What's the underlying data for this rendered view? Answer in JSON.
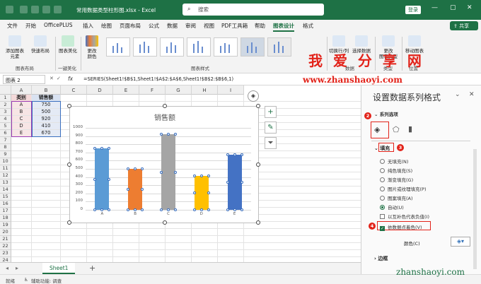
{
  "titlebar": {
    "file_name": "常用数据类型柱形图.xlsx - Excel",
    "search_placeholder": "搜索",
    "login_label": "登录"
  },
  "tabs": [
    "文件",
    "开始",
    "OfficePLUS",
    "插入",
    "绘图",
    "页面布局",
    "公式",
    "数据",
    "审阅",
    "视图",
    "PDF工具箱",
    "帮助",
    "图表设计",
    "格式"
  ],
  "active_tab": "图表设计",
  "share_label": "共享",
  "ribbon": {
    "add_element": "添加图表\n元素",
    "quick_layout": "快速布局",
    "beautify": "图表美化",
    "change_colors": "更改\n颜色",
    "switch_row_col": "切换行/列",
    "select_data": "选择数据",
    "change_type": "更改\n图表类型",
    "move_chart": "移动图表",
    "group_layout": "图表布局",
    "group_onekey": "一键美化",
    "group_styles": "图表样式",
    "group_data": "数据",
    "group_type": "类型",
    "group_location": "位置"
  },
  "watermark": {
    "cn": "我 爱 分 享 网",
    "url": "www.zhanshaoyi.com",
    "url2": "zhanshaoyi.com"
  },
  "formula_bar": {
    "name_box": "图表 2",
    "fx": "fx",
    "formula": "=SERIES(Sheet1!$B$1,Sheet1!$A$2:$A$6,Sheet1!$B$2:$B$6,1)"
  },
  "columns": [
    "A",
    "B",
    "C",
    "D",
    "E",
    "F",
    "G",
    "H",
    "I"
  ],
  "rows": [
    "1",
    "2",
    "3",
    "4",
    "5",
    "6",
    "7",
    "8",
    "9",
    "10",
    "11",
    "12",
    "13",
    "14",
    "15",
    "16",
    "17",
    "18",
    "19",
    "20",
    "21",
    "22",
    "23",
    "24"
  ],
  "table": {
    "header": [
      "类别",
      "销售额"
    ],
    "rows": [
      [
        "A",
        "750"
      ],
      [
        "B",
        "500"
      ],
      [
        "C",
        "920"
      ],
      [
        "D",
        "410"
      ],
      [
        "E",
        "670"
      ]
    ]
  },
  "chart_data": {
    "type": "bar",
    "title": "销售额",
    "categories": [
      "A",
      "B",
      "C",
      "D",
      "E"
    ],
    "values": [
      750,
      500,
      920,
      410,
      670
    ],
    "colors": [
      "#5b9bd5",
      "#ed7d31",
      "#a5a5a5",
      "#ffc000",
      "#4472c4"
    ],
    "yticks": [
      "0",
      "100",
      "200",
      "300",
      "400",
      "500",
      "600",
      "700",
      "800",
      "900",
      "1000"
    ],
    "ylim": [
      0,
      1000
    ],
    "grid": true
  },
  "sheet_tab": "Sheet1",
  "status": {
    "ready": "就绪",
    "accessibility": "辅助功能: 调查"
  },
  "pane": {
    "title": "设置数据系列格式",
    "section": "系列选项",
    "fill_header": "填充",
    "options": [
      "无填充(N)",
      "纯色填充(S)",
      "渐变填充(G)",
      "图片或纹理填充(P)",
      "图案填充(A)",
      "自动(U)"
    ],
    "invert_label": "以互补色代表负值(I)",
    "vary_colors_label": "依数据点着色(V)",
    "color_label": "颜色(C)",
    "border_header": "边框",
    "badge2": "2",
    "badge3": "3",
    "badge4": "4"
  }
}
